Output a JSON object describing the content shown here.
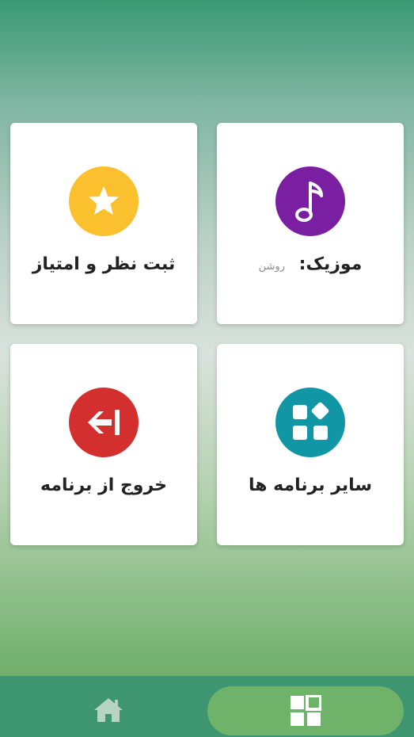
{
  "cards": {
    "music": {
      "title": "موزیک:",
      "status": "روشن",
      "icon": "music-note-icon",
      "color": "#7b1fa2"
    },
    "rate": {
      "title": "ثبت نظر و امتیاز",
      "icon": "star-icon",
      "color": "#fbc02d"
    },
    "other_apps": {
      "title": "سایر برنامه ها",
      "icon": "apps-grid-icon",
      "color": "#1196a6"
    },
    "exit": {
      "title": "خروج از برنامه",
      "icon": "exit-arrow-icon",
      "color": "#d32f2f"
    }
  },
  "navbar": {
    "home_icon": "home-icon",
    "grid_icon": "grid-icon",
    "active": "grid"
  }
}
